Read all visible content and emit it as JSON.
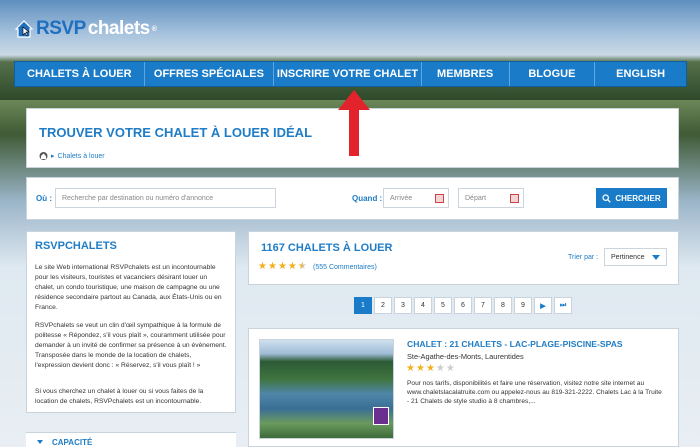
{
  "logo": {
    "prefix": "RSVP",
    "suffix": "chalets",
    "reg": "®"
  },
  "nav": [
    "CHALETS À LOUER",
    "OFFRES SPÉCIALES",
    "INSCRIRE VOTRE CHALET",
    "MEMBRES",
    "BLOGUE",
    "ENGLISH"
  ],
  "hero": {
    "title": "TROUVER VOTRE CHALET À LOUER IDÉAL",
    "breadcrumb": "Chalets à louer"
  },
  "search": {
    "where_label": "Où :",
    "where_placeholder": "Recherche par destination ou numéro d'annonce",
    "when_label": "Quand :",
    "arrival": "Arrivée",
    "departure": "Départ",
    "button": "CHERCHER"
  },
  "sidebar": {
    "title": "RSVPCHALETS",
    "p1": "Le site Web international RSVPchalets est un incontournable pour les visiteurs, touristes et vacanciers désirant louer un chalet, un condo touristique, une maison de campagne ou une résidence secondaire partout au Canada, aux États-Unis ou en France.",
    "p2": "RSVPchalets se veut un clin d'œil sympathique à la formule de politesse « Répondez, s'il vous plaît », couramment utilisée pour demander à un invité de confirmer sa présence à un évènement. Transposée dans le monde de la location de chalets, l'expression devient donc : « Réservez, s'il vous plaît ! »",
    "p3": "Si vous cherchez un chalet à louer ou si vous faites de la location de chalets, RSVPchalets est un incontournable.",
    "capacity": "CAPACITÉ"
  },
  "results": {
    "count_title": "1167 CHALETS À LOUER",
    "rating": 4.5,
    "reviews": "(555 Commentaires)",
    "sort_label": "Trier par :",
    "sort_value": "Pertinence"
  },
  "pager": [
    "1",
    "2",
    "3",
    "4",
    "5",
    "6",
    "7",
    "8",
    "9"
  ],
  "listing": {
    "title": "CHALET : 21 CHALETS - LAC-PLAGE-PISCINE-SPAS",
    "location": "Ste-Agathe-des-Monts, Laurentides",
    "rating": 3,
    "desc": "Pour nos tarifs, disponibilités et faire une réservation, visitez notre site internet au www.chaletslacalatruite.com ou appelez-nous au 819-321-2222. Chalets Lac à la Truite - 21 Chalets de style studio à 8 chambres,..."
  }
}
